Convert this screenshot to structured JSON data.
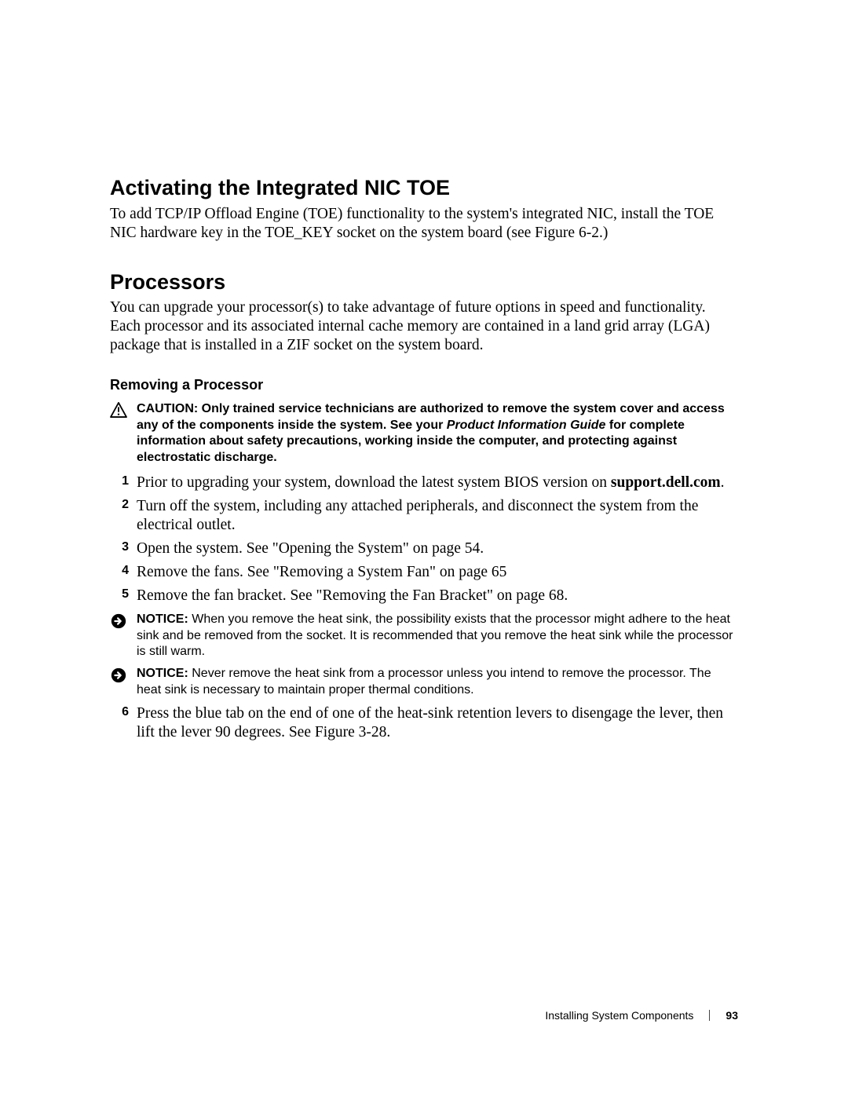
{
  "heading1": "Activating the Integrated NIC TOE",
  "para1": "To add TCP/IP Offload Engine (TOE) functionality to the system's integrated NIC, install the TOE NIC hardware key in the TOE_KEY socket on the system board (see Figure 6-2.)",
  "heading2": "Processors",
  "para2": "You can upgrade your processor(s) to take advantage of future options in speed and functionality. Each processor and its associated internal cache memory are contained in a land grid array (LGA) package that is installed in a ZIF socket on the system board.",
  "subheading": "Removing a Processor",
  "caution": {
    "label": "CAUTION:",
    "before": "Only trained service technicians are authorized to remove the system cover and access any of the components inside the system. See your",
    "italic": "Product Information Guide",
    "after": "for complete information about safety precautions, working inside the computer, and protecting against electrostatic discharge."
  },
  "steps": {
    "s1": {
      "num": "1",
      "before": "Prior to upgrading your system, download the latest system BIOS version on ",
      "bold": "support.dell.com",
      "after": "."
    },
    "s2": {
      "num": "2",
      "text": "Turn off the system, including any attached peripherals, and disconnect the system from the electrical outlet."
    },
    "s3": {
      "num": "3",
      "text": "Open the system. See \"Opening the System\" on page 54."
    },
    "s4": {
      "num": "4",
      "text": "Remove the fans. See \"Removing a System Fan\" on page 65"
    },
    "s5": {
      "num": "5",
      "text": "Remove the fan bracket. See \"Removing the Fan Bracket\" on page 68."
    },
    "s6": {
      "num": "6",
      "text": "Press the blue tab on the end of one of the heat-sink retention levers to disengage the lever, then lift the lever 90 degrees. See Figure 3-28."
    }
  },
  "notice1": {
    "label": "NOTICE:",
    "text": "When you remove the heat sink, the possibility exists that the processor might adhere to the heat sink and be removed from the socket. It is recommended that you remove the heat sink while the processor is still warm."
  },
  "notice2": {
    "label": "NOTICE:",
    "text": "Never remove the heat sink from a processor unless you intend to remove the processor. The heat sink is necessary to maintain proper thermal conditions."
  },
  "footer": {
    "title": "Installing System Components",
    "page": "93"
  }
}
